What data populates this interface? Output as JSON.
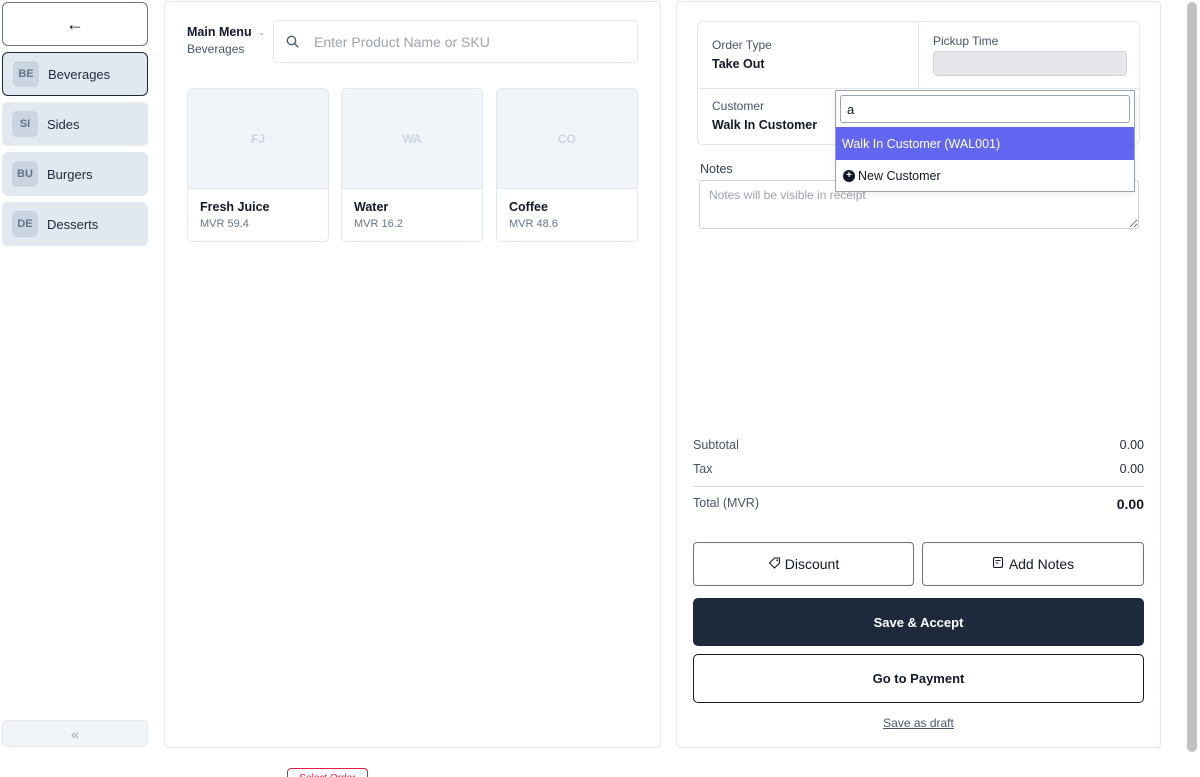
{
  "sidebar": {
    "back_icon": "←",
    "categories": [
      {
        "badge": "BE",
        "label": "Beverages"
      },
      {
        "badge": "SI",
        "label": "Sides"
      },
      {
        "badge": "BU",
        "label": "Burgers"
      },
      {
        "badge": "DE",
        "label": "Desserts"
      }
    ],
    "collapse_icon": "«"
  },
  "products": {
    "menu_label": "Main Menu",
    "menu_chevron": "⌄",
    "current_category": "Beverages",
    "search_placeholder": "Enter Product Name or SKU",
    "items": [
      {
        "initials": "FJ",
        "name": "Fresh Juice",
        "price": "MVR 59.4"
      },
      {
        "initials": "WA",
        "name": "Water",
        "price": "MVR 16.2"
      },
      {
        "initials": "CO",
        "name": "Coffee",
        "price": "MVR 48.6"
      }
    ],
    "partial_button_label": "Select Order"
  },
  "order": {
    "order_type_label": "Order Type",
    "order_type_value": "Take Out",
    "pickup_time_label": "Pickup Time",
    "pickup_time_value": "",
    "customer_label": "Customer",
    "customer_value": "Walk In Customer",
    "notes_label": "Notes",
    "notes_placeholder": "Notes will be visible in receipt",
    "subtotal_label": "Subtotal",
    "subtotal_value": "0.00",
    "tax_label": "Tax",
    "tax_value": "0.00",
    "total_label": "Total (MVR)",
    "total_value": "0.00",
    "discount_label": "Discount",
    "add_notes_label": "Add Notes",
    "save_accept_label": "Save & Accept",
    "payment_label": "Go to Payment",
    "draft_label": "Save as draft"
  },
  "customer_dropdown": {
    "search_value": "a",
    "options": [
      {
        "label": "Walk In Customer (WAL001)",
        "selected": true
      },
      {
        "label": "New Customer",
        "selected": false
      }
    ]
  },
  "colors": {
    "primary_dark": "#1e293b",
    "dropdown_highlight": "#6366f1",
    "category_bg": "#e2e8f0",
    "danger": "#e11d48"
  }
}
